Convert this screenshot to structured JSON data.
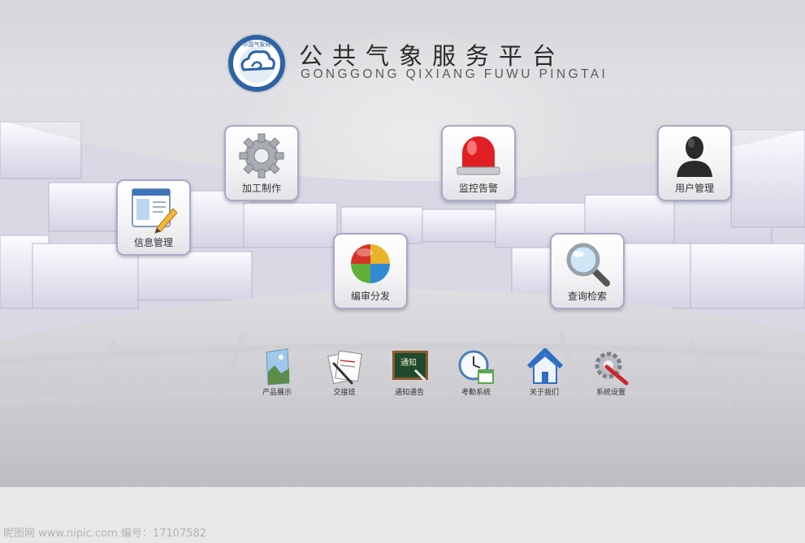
{
  "header": {
    "title_cn": "公共气象服务平台",
    "title_en": "GONGGONG QIXIANG FUWU PINGTAI",
    "logo_text": "中国气象局"
  },
  "tiles": [
    {
      "label": "信息管理",
      "icon": "document-edit-icon"
    },
    {
      "label": "加工制作",
      "icon": "gear-icon"
    },
    {
      "label": "编审分发",
      "icon": "color-ball-icon"
    },
    {
      "label": "监控告警",
      "icon": "alarm-light-icon"
    },
    {
      "label": "查询检索",
      "icon": "magnifier-icon"
    },
    {
      "label": "用户管理",
      "icon": "user-icon"
    }
  ],
  "dock": [
    {
      "label": "产品展示",
      "icon": "picture-icon"
    },
    {
      "label": "交接班",
      "icon": "notes-pen-icon"
    },
    {
      "label": "通知通告",
      "icon": "blackboard-icon",
      "board_text": "通知"
    },
    {
      "label": "考勤系统",
      "icon": "clock-calendar-icon"
    },
    {
      "label": "关于我们",
      "icon": "home-icon"
    },
    {
      "label": "系统设置",
      "icon": "gear-tools-icon"
    }
  ],
  "watermark": "昵图网 www.nipic.com   编号：17107582",
  "colors": {
    "tile_border": "#a9a9c9",
    "title": "#2b2b2b",
    "logo_blue": "#2b63a3"
  }
}
